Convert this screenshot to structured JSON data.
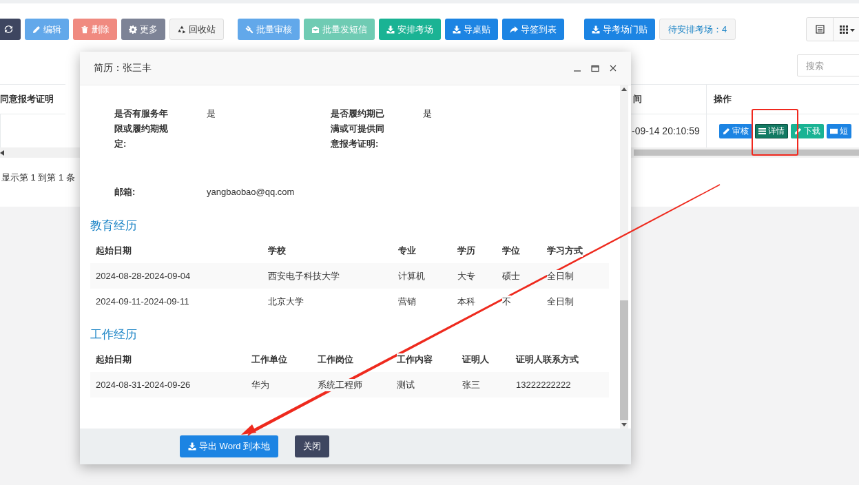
{
  "toolbar": {
    "buttons": [
      {
        "kind": "icon-button",
        "color": "#3e4660"
      },
      {
        "kind": "button",
        "label": "编辑",
        "color": "#62a8ea"
      },
      {
        "kind": "button",
        "label": "删除",
        "color": "#f08a80"
      },
      {
        "kind": "button",
        "label": "更多",
        "color": "#7d8396"
      },
      {
        "kind": "button",
        "label": "回收站",
        "color": "#f4f4f4"
      },
      {
        "kind": "button",
        "label": "批量审核",
        "color": "#62a8ea"
      },
      {
        "kind": "button",
        "label": "批量发短信",
        "color": "#6fcbb3"
      },
      {
        "kind": "button",
        "label": "安排考场",
        "color": "#1ab394"
      },
      {
        "kind": "button",
        "label": "导桌贴",
        "color": "#1c84e3"
      },
      {
        "kind": "button",
        "label": "导签到表",
        "color": "#1c84e3"
      },
      {
        "kind": "button",
        "label": "导考场门贴",
        "color": "#1c84e3"
      }
    ],
    "pending_badge": "待安排考场：4"
  },
  "search": {
    "placeholder": "搜索"
  },
  "table": {
    "columns": [
      "同意报考证明",
      "间",
      "操作"
    ],
    "rows": [
      {
        "cells": [
          "",
          "-09-14 20:10:59"
        ],
        "actions": [
          {
            "label": "审核",
            "color": "#1c84e3"
          },
          {
            "label": "详情",
            "color": "#137a63"
          },
          {
            "label": "下载",
            "color": "#1ab394"
          },
          {
            "label": "短",
            "color": "#1c84e3"
          }
        ]
      }
    ]
  },
  "pagination": "显示第 1 到第 1 条",
  "modal": {
    "title": "简历：张三丰",
    "fields": [
      {
        "label": "是否有服务年限或履约期规定:",
        "value": "是"
      },
      {
        "label": "是否履约期已满或可提供同意报考证明:",
        "value": "是"
      },
      {
        "label": "邮箱:",
        "value": "yangbaobao@qq.com"
      }
    ],
    "sections": [
      {
        "title": "教育经历",
        "columns": [
          "起始日期",
          "学校",
          "专业",
          "学历",
          "学位",
          "学习方式"
        ],
        "rows": [
          [
            "2024-08-28-2024-09-04",
            "西安电子科技大学",
            "计算机",
            "大专",
            "硕士",
            "全日制"
          ],
          [
            "2024-09-11-2024-09-11",
            "北京大学",
            "营销",
            "本科",
            "不",
            "全日制"
          ]
        ]
      },
      {
        "title": "工作经历",
        "columns": [
          "起始日期",
          "工作单位",
          "工作岗位",
          "工作内容",
          "证明人",
          "证明人联系方式"
        ],
        "rows": [
          [
            "2024-08-31-2024-09-26",
            "华为",
            "系统工程师",
            "测试",
            "张三",
            "13222222222"
          ]
        ]
      }
    ],
    "footer_buttons": [
      {
        "kind": "export",
        "label": "导出 Word 到本地",
        "color": "#1c84e3"
      },
      {
        "kind": "close",
        "label": "关闭",
        "color": "#3e4660"
      }
    ]
  }
}
